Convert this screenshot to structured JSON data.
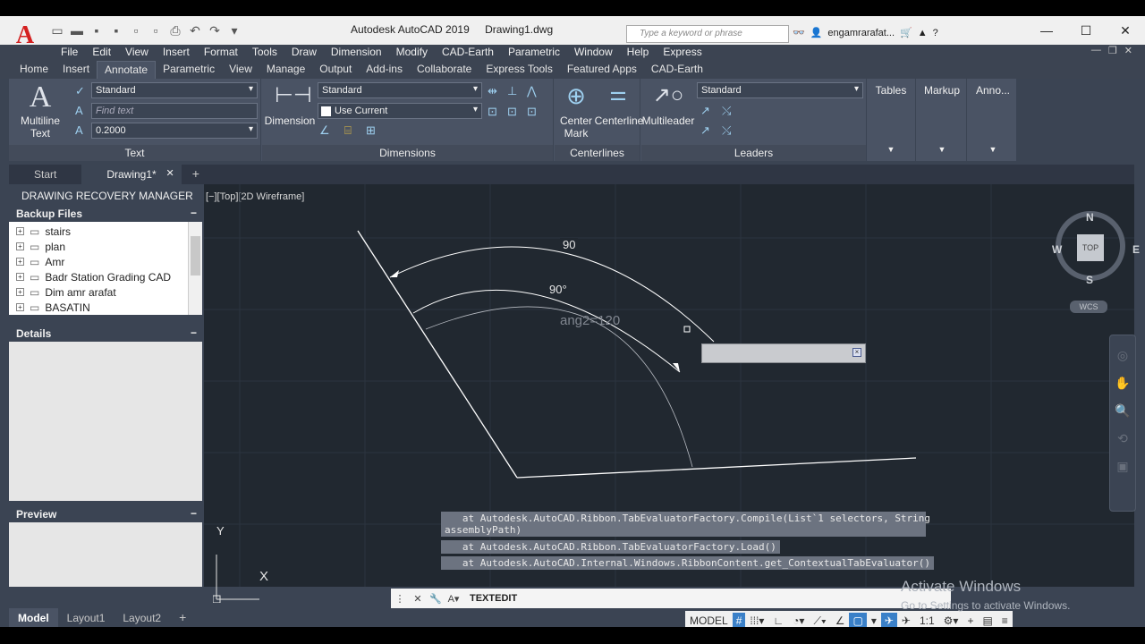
{
  "app": {
    "title": "Autodesk AutoCAD 2019",
    "document": "Drawing1.dwg",
    "search_placeholder": "Type a keyword or phrase",
    "user": "engamrarafat..."
  },
  "menu": [
    "File",
    "Edit",
    "View",
    "Insert",
    "Format",
    "Tools",
    "Draw",
    "Dimension",
    "Modify",
    "CAD-Earth",
    "Parametric",
    "Window",
    "Help",
    "Express"
  ],
  "ribbon_tabs": [
    "Home",
    "Insert",
    "Annotate",
    "Parametric",
    "View",
    "Manage",
    "Output",
    "Add-ins",
    "Collaborate",
    "Express Tools",
    "Featured Apps",
    "CAD-Earth"
  ],
  "active_ribbon_tab": "Annotate",
  "panels": {
    "text": {
      "label": "Text",
      "multiline_label": "Multiline",
      "multiline_label2": "Text",
      "style": "Standard",
      "find_placeholder": "Find text",
      "height": "0.2000"
    },
    "dimensions": {
      "label": "Dimensions",
      "button": "Dimension",
      "style": "Standard",
      "layer": "Use Current"
    },
    "centerlines": {
      "label": "Centerlines",
      "center_mark": "Center",
      "center_mark2": "Mark",
      "centerline": "Centerline"
    },
    "leaders": {
      "label": "Leaders",
      "button": "Multileader",
      "style": "Standard"
    },
    "tables": "Tables",
    "markup": "Markup",
    "anno": "Anno..."
  },
  "file_tabs": [
    "Start",
    "Drawing1*"
  ],
  "recovery": {
    "title": "DRAWING RECOVERY MANAGER",
    "backup_header": "Backup Files",
    "files": [
      "stairs",
      "plan",
      "Amr",
      "Badr Station Grading CAD",
      "Dim amr arafat",
      "BASATIN"
    ],
    "details_header": "Details",
    "preview_header": "Preview"
  },
  "viewport": {
    "label": "[−][Top][2D Wireframe]",
    "dim_outer": "90",
    "dim_inner": "90°",
    "param_label": "ang2=120",
    "viewcube_top": "TOP",
    "compass_n": "N",
    "compass_s": "S",
    "compass_e": "E",
    "compass_w": "W",
    "wcs": "WCS",
    "ucs_x": "X",
    "ucs_y": "Y"
  },
  "command_history": [
    "   at Autodesk.AutoCAD.Ribbon.TabEvaluatorFactory.Compile(List`1 selectors, String\nassemblyPath)",
    "   at Autodesk.AutoCAD.Ribbon.TabEvaluatorFactory.Load()",
    "   at Autodesk.AutoCAD.Internal.Windows.RibbonContent.get_ContextualTabEvaluator()"
  ],
  "command_line": "TEXTEDIT",
  "layout_tabs": [
    "Model",
    "Layout1",
    "Layout2"
  ],
  "status": {
    "model": "MODEL",
    "scale": "1:1"
  },
  "watermark": {
    "line1": "Activate Windows",
    "line2": "Go to Settings to activate Windows."
  }
}
